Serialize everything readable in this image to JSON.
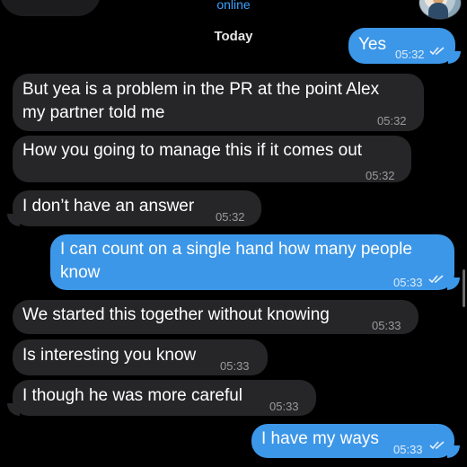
{
  "header": {
    "status": "online",
    "contact_avatar": "contact-photo"
  },
  "date_separator": "Today",
  "messages": [
    {
      "text": "Yes",
      "time": "05:32",
      "direction": "out",
      "read": true
    },
    {
      "line1": "But yea is a problem in the PR at the point Alex",
      "line2": "my partner told me",
      "time": "05:32",
      "direction": "in"
    },
    {
      "text": "How you going to manage this if it comes out",
      "time": "05:32",
      "direction": "in"
    },
    {
      "text": "I don’t have an answer",
      "time": "05:32",
      "direction": "in"
    },
    {
      "line1": "I can count on a single hand how many people",
      "line2": "know",
      "time": "05:33",
      "direction": "out",
      "read": true
    },
    {
      "text": "We started this together without knowing",
      "time": "05:33",
      "direction": "in"
    },
    {
      "text": "Is interesting you know",
      "time": "05:33",
      "direction": "in"
    },
    {
      "text": "I though he was more careful",
      "time": "05:33",
      "direction": "in"
    },
    {
      "text": "I have my ways",
      "time": "05:33",
      "direction": "out",
      "read": true
    }
  ],
  "colors": {
    "incoming_bubble": "#262628",
    "outgoing_bubble": "#3d97e8",
    "background": "#000000",
    "accent": "#3aa0ff"
  }
}
